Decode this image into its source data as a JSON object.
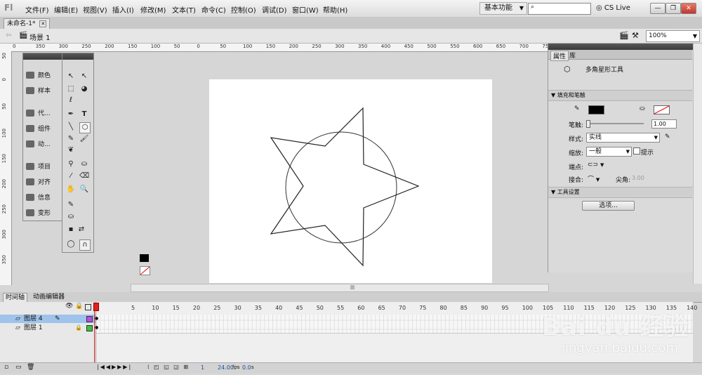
{
  "app": {
    "logo": "Fl",
    "menus": [
      "文件(F)",
      "编辑(E)",
      "视图(V)",
      "插入(I)",
      "修改(M)",
      "文本(T)",
      "命令(C)",
      "控制(O)",
      "调试(D)",
      "窗口(W)",
      "帮助(H)"
    ],
    "workspace": "基本功能",
    "cs_live": "CS Live"
  },
  "document": {
    "tab": "未命名-1*",
    "scene": "场景 1",
    "zoom": "100%"
  },
  "rulers": {
    "h_ticks": [
      "0",
      "350",
      "300",
      "250",
      "200",
      "150",
      "100",
      "50",
      "0",
      "50",
      "100",
      "150",
      "200",
      "250",
      "300",
      "350",
      "400",
      "450",
      "500",
      "550",
      "600",
      "650",
      "700",
      "750"
    ],
    "v_ticks": [
      "50",
      "0",
      "50",
      "100",
      "150",
      "200",
      "250",
      "300",
      "350"
    ]
  },
  "dock": {
    "items": [
      "颜色",
      "样本",
      "代...",
      "组件",
      "动...",
      "项目",
      "对齐",
      "信息",
      "变形"
    ]
  },
  "properties": {
    "tabs": [
      "属性",
      "库"
    ],
    "tool_name": "多角星形工具",
    "fill_stroke_header": "填充和笔触",
    "stroke_label": "笔触:",
    "stroke_value": "1.00",
    "style_label": "样式:",
    "style_value": "实线",
    "scale_label": "缩放:",
    "scale_value": "一般",
    "hint_label": "提示",
    "cap_label": "端点:",
    "join_label": "接合:",
    "miter_label": "尖角:",
    "miter_value": "3.00",
    "tool_settings_header": "工具设置",
    "options_button": "选项..."
  },
  "timeline": {
    "tabs": [
      "时间轴",
      "动画编辑器"
    ],
    "frame_numbers": [
      "5",
      "10",
      "15",
      "20",
      "25",
      "30",
      "35",
      "40",
      "45",
      "50",
      "55",
      "60",
      "65",
      "70",
      "75",
      "80",
      "85",
      "90",
      "95",
      "100",
      "105",
      "110",
      "115",
      "120",
      "125",
      "130",
      "135",
      "140"
    ],
    "layers": [
      {
        "name": "图层 4",
        "selected": true,
        "color": "#b84fe6"
      },
      {
        "name": "图层 1",
        "selected": false,
        "color": "#3fbf3f"
      }
    ],
    "current_frame": "1",
    "fps": "24.00",
    "fps_unit": "fps",
    "time": "0.0",
    "time_unit": "s"
  },
  "watermark": {
    "brand": "Bai du 经验",
    "url": "jingyan.baidu.com"
  },
  "colors": {
    "stroke_swatch": "#000000",
    "selection": "#9fc3ea",
    "playhead": "#e02020"
  }
}
